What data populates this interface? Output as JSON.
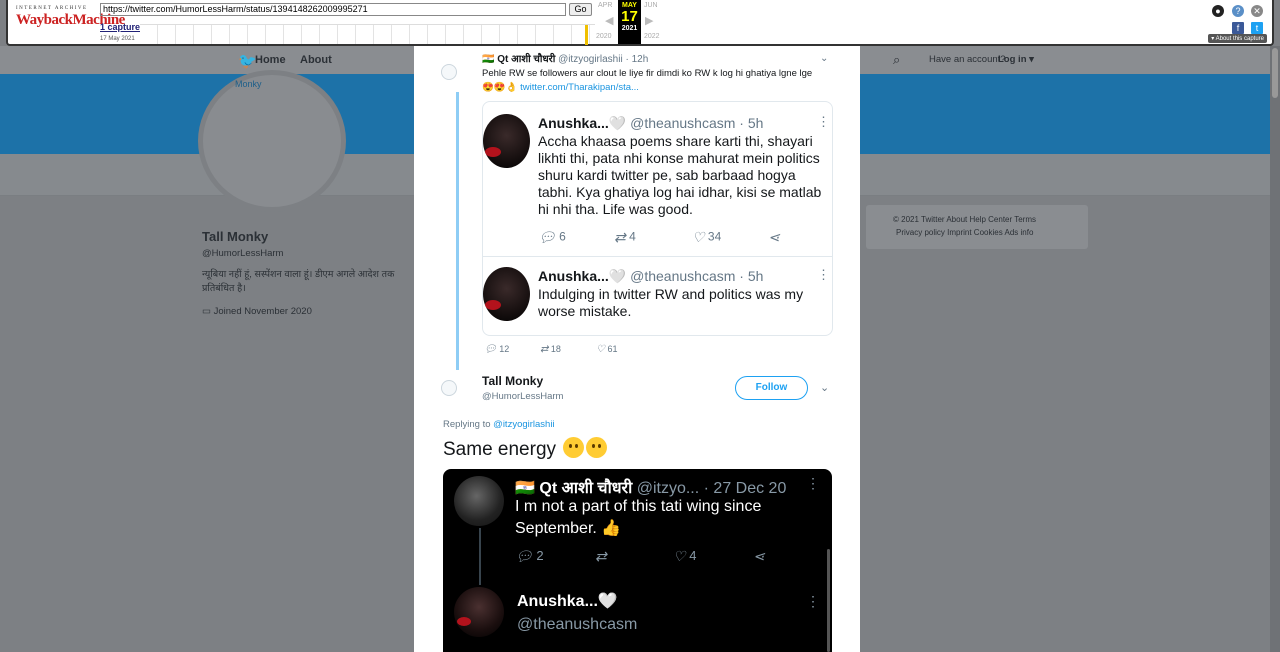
{
  "wayback": {
    "logo_top": "INTERNET ARCHIVE",
    "logo_main": "WaybackMachine",
    "url": "https://twitter.com/HumorLessHarm/status/1394148262009995271",
    "go_label": "Go",
    "captures": "1 capture",
    "capture_date": "17 May 2021",
    "cal_prev_month": "APR",
    "cal_month": "MAY",
    "cal_next_month": "JUN",
    "cal_day": "17",
    "cal_prev_year": "2020",
    "cal_year": "2021",
    "cal_next_year": "2022",
    "about_label": "About this capture"
  },
  "twitter_bg": {
    "nav_home": "Home",
    "nav_about": "About",
    "account_prompt": "Have an account?",
    "login": "Log in",
    "avatar_alt": "Monky",
    "profile_name": "Tall Monky",
    "profile_handle": "@HumorLessHarm",
    "profile_bio": "न्यूबिया नहीं हूं, सस्पेंशन वाला हूं। डीएम अगले आदेश तक प्रतिबंधित है।",
    "joined": "Joined November 2020",
    "footer_line1": "© 2021 Twitter   About   Help Center   Terms",
    "footer_line2": "Privacy policy   Imprint   Cookies   Ads info"
  },
  "quoted": {
    "flag": "🇮🇳",
    "name": "Qt आशी चौधरी",
    "handle": "@itzyogirlashii",
    "time": "· 12h",
    "text": "Pehle RW se followers aur clout le liye fir dimdi ko RW k log hi ghatiya lgne lge",
    "emojis": "😍😍👌",
    "link": "twitter.com/Tharakipan/sta...",
    "stats": {
      "replies": "12",
      "retweets": "18",
      "likes": "61"
    }
  },
  "replies": [
    {
      "name": "Anushka...🤍",
      "handle": "@theanushcasm",
      "time": "· 5h",
      "text": "Accha khaasa poems share karti thi, shayari likhti thi, pata nhi konse mahurat mein politics shuru kardi twitter pe, sab barbaad hogya tabhi. Kya ghatiya log hai idhar, kisi se matlab hi nhi tha. Life was good.",
      "replies": "6",
      "retweets": "4",
      "likes": "34"
    },
    {
      "name": "Anushka...🤍",
      "handle": "@theanushcasm",
      "time": "· 5h",
      "text": "Indulging in twitter RW and politics was my worse mistake."
    }
  ],
  "main_tweet": {
    "name": "Tall Monky",
    "handle": "@HumorLessHarm",
    "follow_label": "Follow",
    "replying_prefix": "Replying to",
    "replying_to": "@itzyogirlashii",
    "text": "Same energy"
  },
  "embedded": {
    "flag": "🇮🇳",
    "name": "Qt आशी चौधरी",
    "handle": "@itzyo...",
    "date": "· 27 Dec 20",
    "text": "I m not a part of this tati wing since September. 👍",
    "replies": "2",
    "likes": "4",
    "name2": "Anushka...🤍",
    "handle2": "@theanushcasm"
  }
}
